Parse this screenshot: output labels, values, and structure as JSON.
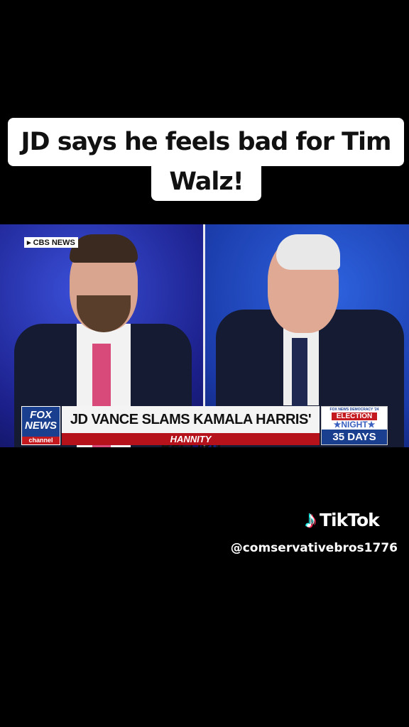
{
  "caption": {
    "line1": "JD says he feels bad for Tim",
    "line2": "Walz!"
  },
  "video": {
    "network_bug": "▸ CBS NEWS",
    "chyron": {
      "logo_line1": "FOX",
      "logo_line2": "NEWS",
      "logo_line3": "channel",
      "headline": "JD VANCE SLAMS KAMALA HARRIS' RECORD",
      "show": "HANNITY",
      "countdown_top": "FOX NEWS DEMOCRACY '24",
      "countdown_label1": "ELECTION",
      "countdown_label2": "★NIGHT★",
      "countdown_days": "35 DAYS"
    }
  },
  "watermark": {
    "brand": "TikTok",
    "icon": "tiktok-note-icon",
    "handle": "@comservativebros1776"
  },
  "colors": {
    "fox_blue": "#1b3f8f",
    "fox_red": "#b5121b",
    "tiktok_cyan": "#25f4ee",
    "tiktok_pink": "#fe2c55"
  }
}
